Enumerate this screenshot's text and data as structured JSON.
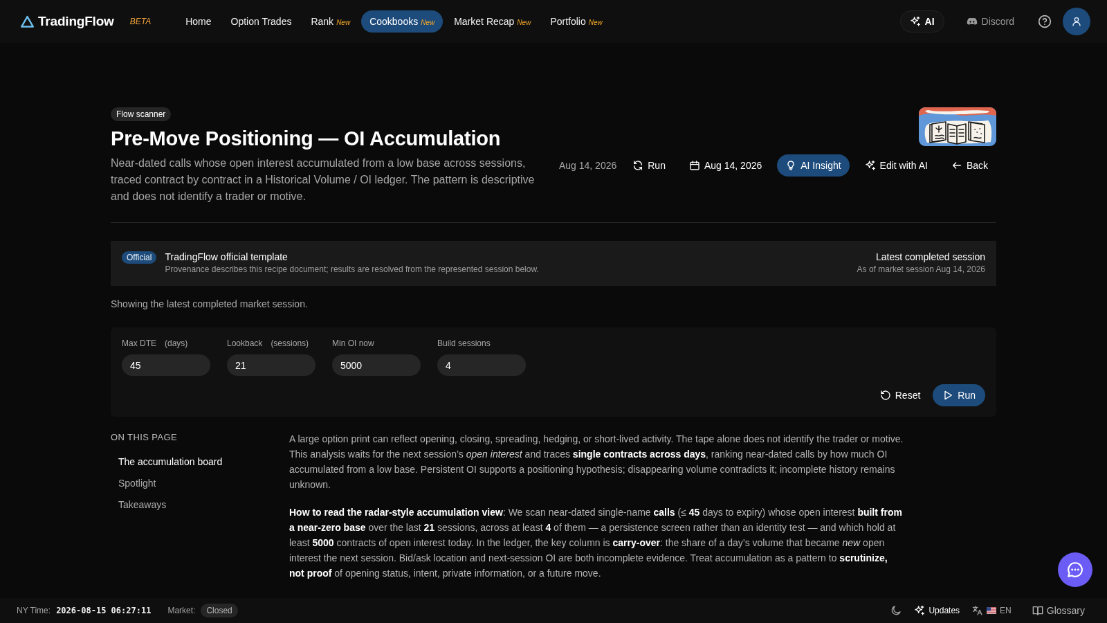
{
  "nav": {
    "logo": "TradingFlow",
    "badge": "BETA",
    "items": [
      {
        "label": "Home",
        "selected": false
      },
      {
        "label": "Option Trades",
        "selected": false
      },
      {
        "label": "Rank",
        "tag": "New",
        "selected": false
      },
      {
        "label": "Cookbooks",
        "tag": "New",
        "selected": true
      },
      {
        "label": "Market Recap",
        "tag": "New",
        "selected": false
      },
      {
        "label": "Portfolio",
        "tag": "New",
        "selected": false
      }
    ],
    "ai_button": "AI",
    "discord": "Discord"
  },
  "header": {
    "category": "Flow scanner",
    "title": "Pre-Move Positioning — OI Accumulation",
    "description": "Near-dated calls whose open interest accumulated from a low base across sessions, traced contract by contract in a Historical Volume / OI ledger. The pattern is descriptive and does not identify a trader or motive.",
    "actions": [
      {
        "kind": "date",
        "label": "Aug 14, 2026"
      },
      {
        "kind": "run",
        "label": "Run"
      },
      {
        "kind": "calendar",
        "label": "Aug 14, 2026"
      },
      {
        "kind": "insight",
        "label": "AI Insight"
      },
      {
        "kind": "edit",
        "label": "Edit with AI"
      },
      {
        "kind": "back",
        "label": "Back"
      }
    ]
  },
  "provenance": {
    "badge": "Official",
    "title": "TradingFlow official template",
    "subtitle": "Provenance describes this recipe document; results are resolved from the represented session below.",
    "session_title": "Latest completed session",
    "session_subtitle": "As of market session Aug 14, 2026"
  },
  "session_note": "Showing the latest completed market session.",
  "parameters": {
    "fields": [
      {
        "label": "Max DTE",
        "unit": "(days)",
        "value": "45"
      },
      {
        "label": "Lookback",
        "unit": "(sessions)",
        "value": "21"
      },
      {
        "label": "Min OI now",
        "value": "5000"
      },
      {
        "label": "Build sessions",
        "value": "4"
      }
    ],
    "buttons": [
      {
        "kind": "reset",
        "label": "Reset"
      },
      {
        "kind": "run",
        "label": "Run"
      }
    ]
  },
  "toc": {
    "heading": "ON THIS PAGE",
    "items": [
      {
        "label": "The accumulation board",
        "selected": true
      },
      {
        "label": "Spotlight",
        "selected": false
      },
      {
        "label": "Takeaways",
        "selected": false
      }
    ]
  },
  "article": {
    "paragraphs": [
      "A large option print can reflect opening, closing, spreading, hedging, or short-lived activity. The tape alone does not identify the trader or motive. This analysis waits for the next session’s *open interest* and traces **single contracts across days**, ranking near-dated calls by how much OI accumulated from a low base. Persistent OI supports a positioning hypothesis; disappearing volume contradicts it; incomplete history remains unknown.",
      "**How to read the radar-style accumulation view**: We scan near-dated single-name **calls** (≤ **45** days to expiry) whose open interest **built from a near-zero base** over the last **21** sessions, across at least **4** of them — a persistence screen rather than an identity test — and which hold at least **5000** contracts of open interest today. In the ledger, the key column is **carry-over**: the share of a day’s volume that became *new* open interest the next session. Bid/ask location and next-session OI are both incomplete evidence. Treat accumulation as a pattern to **scrutinize, not proof** of opening status, intent, private information, or a future move."
    ]
  },
  "status_bar": {
    "time_label": "NY Time:",
    "time": "2026-08-15 06:27:11",
    "market_label": "Market:",
    "market_status": "Closed",
    "items": [
      {
        "kind": "theme"
      },
      {
        "kind": "updates",
        "label": "Updates"
      },
      {
        "kind": "language",
        "label": "EN"
      },
      {
        "kind": "glossary",
        "label": "Glossary"
      }
    ]
  }
}
